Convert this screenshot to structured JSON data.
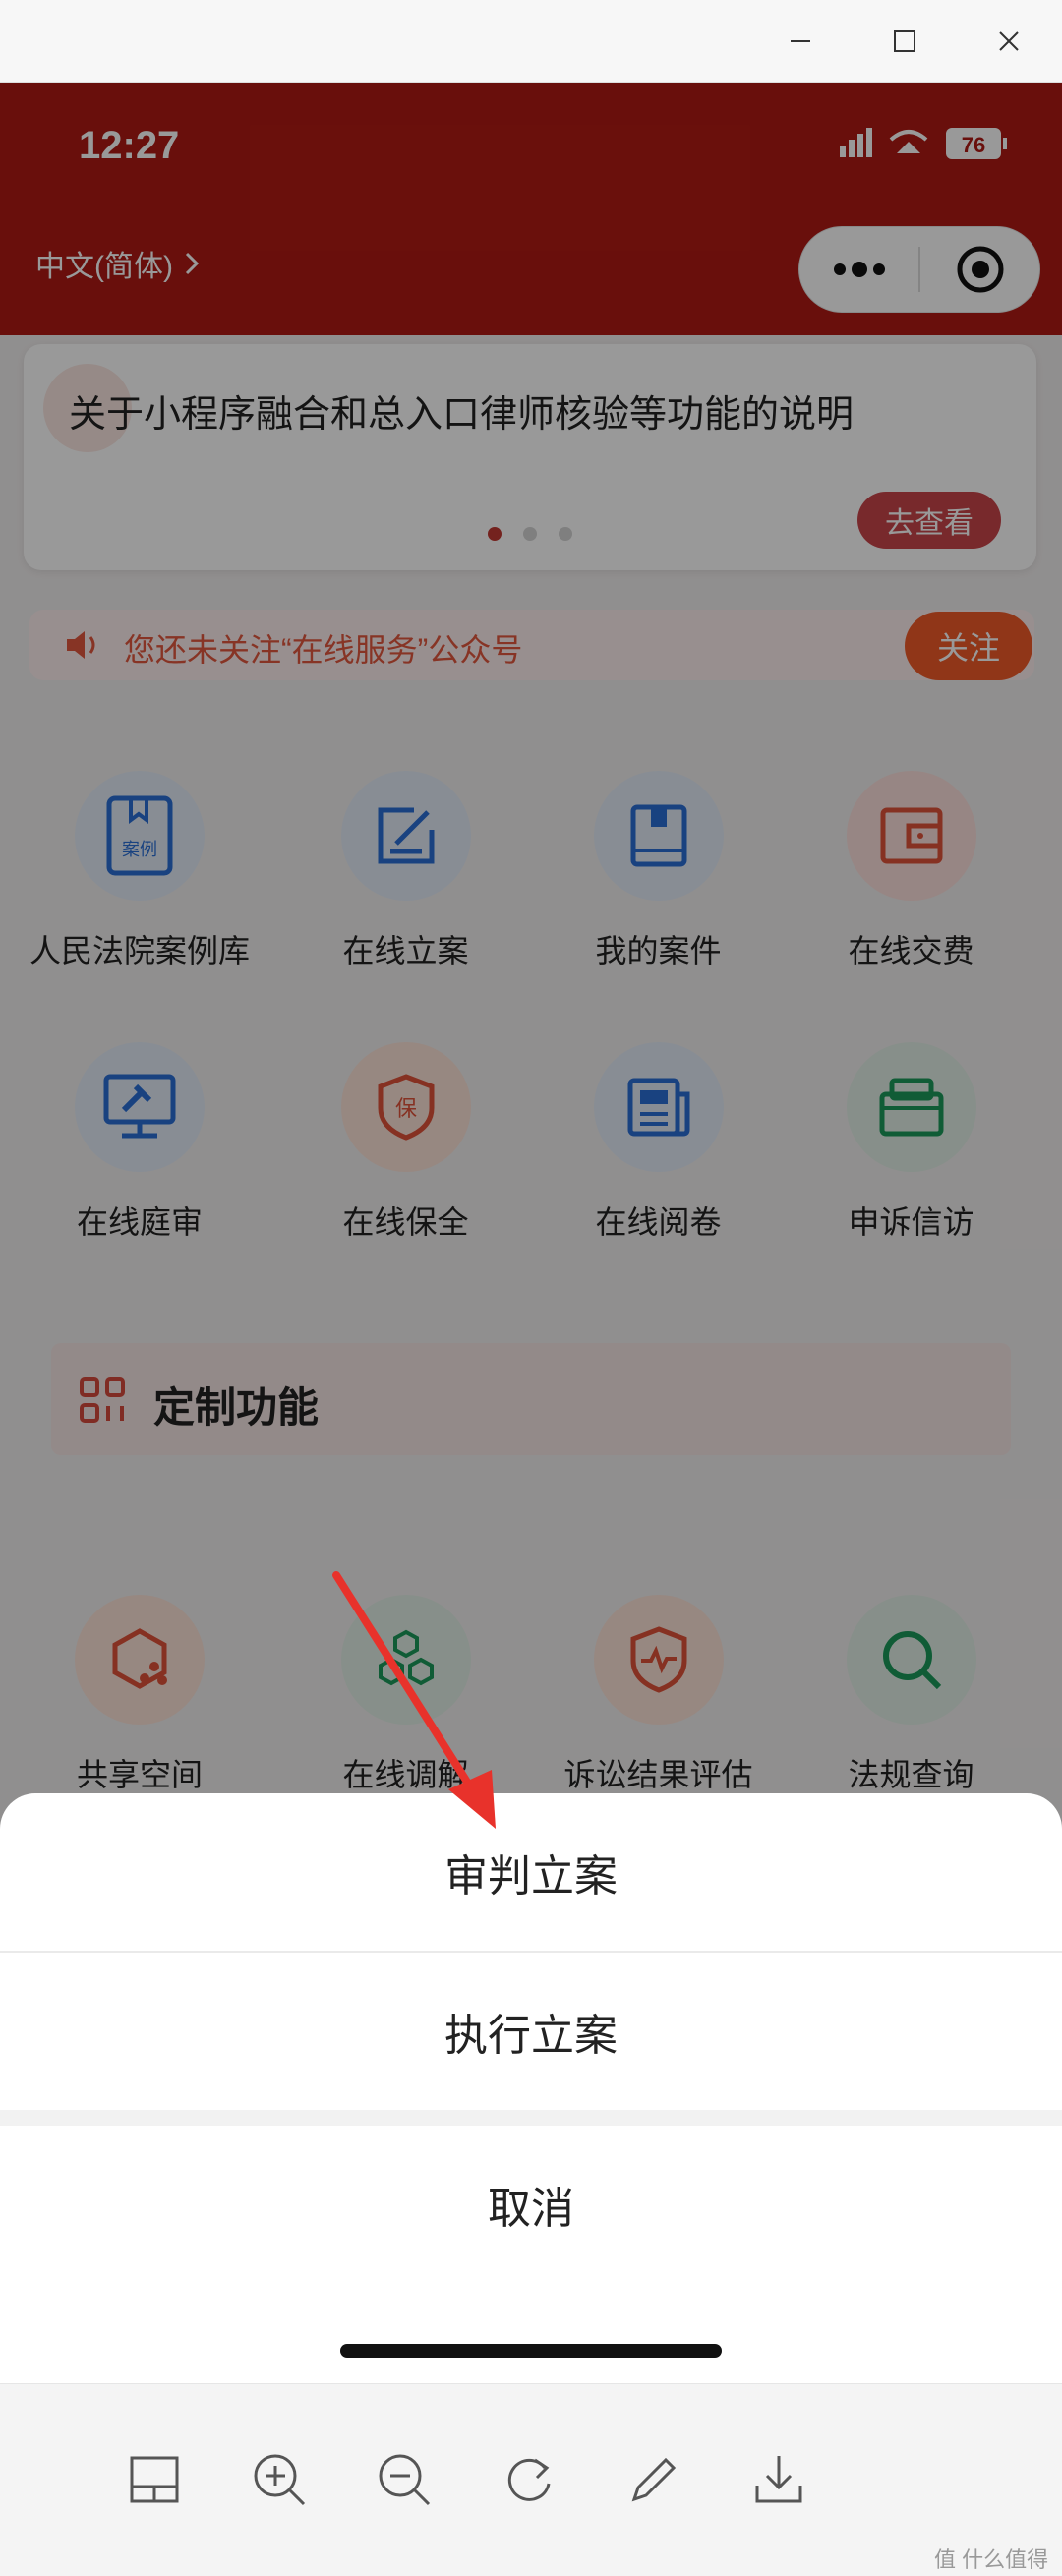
{
  "status": {
    "time": "12:27",
    "battery": "76"
  },
  "header": {
    "language": "中文(简体)"
  },
  "notice": {
    "title": "关于小程序融合和总入口律师核验等功能的说明",
    "view_label": "去查看",
    "dots": 3,
    "active_dot": 0
  },
  "follow": {
    "text": "您还未关注“在线服务”公众号",
    "button": "关注"
  },
  "grid_rows": [
    [
      {
        "label": "人民法院案例库",
        "icon": "case-library-icon",
        "color": "blue"
      },
      {
        "label": "在线立案",
        "icon": "edit-file-icon",
        "color": "blue"
      },
      {
        "label": "我的案件",
        "icon": "book-icon",
        "color": "blue"
      },
      {
        "label": "在线交费",
        "icon": "wallet-icon",
        "color": "red"
      }
    ],
    [
      {
        "label": "在线庭审",
        "icon": "court-monitor-icon",
        "color": "blue"
      },
      {
        "label": "在线保全",
        "icon": "shield-icon",
        "color": "orange"
      },
      {
        "label": "在线阅卷",
        "icon": "newspaper-icon",
        "color": "blue"
      },
      {
        "label": "申诉信访",
        "icon": "mailbox-icon",
        "color": "green"
      }
    ],
    [
      {
        "label": "共享空间",
        "icon": "hexagon-share-icon",
        "color": "orange"
      },
      {
        "label": "在线调解",
        "icon": "hexagons-icon",
        "color": "green"
      },
      {
        "label": "诉讼结果评估",
        "icon": "shield-pulse-icon",
        "color": "orange"
      },
      {
        "label": "法规查询",
        "icon": "search-icon",
        "color": "green"
      }
    ]
  ],
  "section": {
    "title": "定制功能"
  },
  "sheet": {
    "option1": "审判立案",
    "option2": "执行立案",
    "cancel": "取消"
  },
  "toolbar": [
    "layout-icon",
    "zoom-in-icon",
    "zoom-out-icon",
    "rotate-icon",
    "edit-icon",
    "download-icon"
  ],
  "watermark": "值 什么值得买",
  "colors": {
    "header_red": "#b01a14",
    "follow_orange": "#f15a29",
    "arrow_red": "#e8322b"
  }
}
